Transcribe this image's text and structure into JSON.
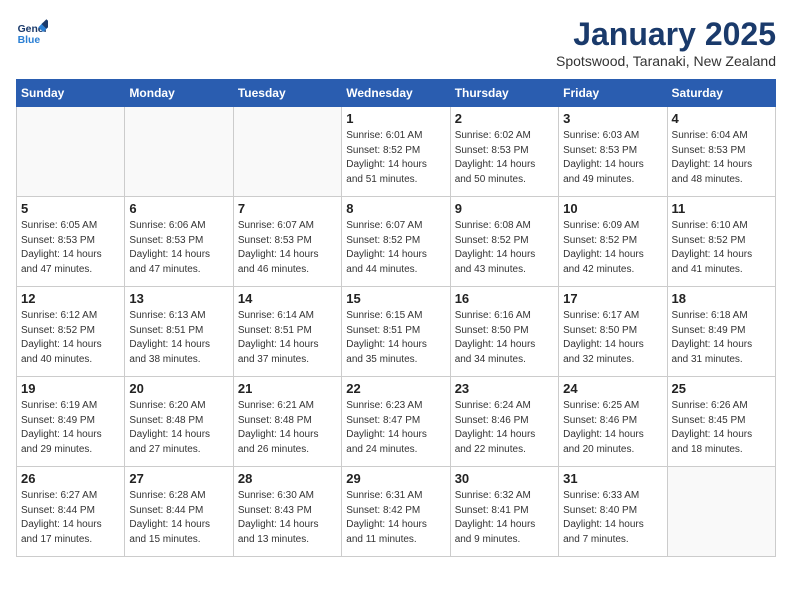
{
  "header": {
    "logo_line1": "General",
    "logo_line2": "Blue",
    "month": "January 2025",
    "location": "Spotswood, Taranaki, New Zealand"
  },
  "days_of_week": [
    "Sunday",
    "Monday",
    "Tuesday",
    "Wednesday",
    "Thursday",
    "Friday",
    "Saturday"
  ],
  "weeks": [
    [
      {
        "day": "",
        "info": ""
      },
      {
        "day": "",
        "info": ""
      },
      {
        "day": "",
        "info": ""
      },
      {
        "day": "1",
        "info": "Sunrise: 6:01 AM\nSunset: 8:52 PM\nDaylight: 14 hours\nand 51 minutes."
      },
      {
        "day": "2",
        "info": "Sunrise: 6:02 AM\nSunset: 8:53 PM\nDaylight: 14 hours\nand 50 minutes."
      },
      {
        "day": "3",
        "info": "Sunrise: 6:03 AM\nSunset: 8:53 PM\nDaylight: 14 hours\nand 49 minutes."
      },
      {
        "day": "4",
        "info": "Sunrise: 6:04 AM\nSunset: 8:53 PM\nDaylight: 14 hours\nand 48 minutes."
      }
    ],
    [
      {
        "day": "5",
        "info": "Sunrise: 6:05 AM\nSunset: 8:53 PM\nDaylight: 14 hours\nand 47 minutes."
      },
      {
        "day": "6",
        "info": "Sunrise: 6:06 AM\nSunset: 8:53 PM\nDaylight: 14 hours\nand 47 minutes."
      },
      {
        "day": "7",
        "info": "Sunrise: 6:07 AM\nSunset: 8:53 PM\nDaylight: 14 hours\nand 46 minutes."
      },
      {
        "day": "8",
        "info": "Sunrise: 6:07 AM\nSunset: 8:52 PM\nDaylight: 14 hours\nand 44 minutes."
      },
      {
        "day": "9",
        "info": "Sunrise: 6:08 AM\nSunset: 8:52 PM\nDaylight: 14 hours\nand 43 minutes."
      },
      {
        "day": "10",
        "info": "Sunrise: 6:09 AM\nSunset: 8:52 PM\nDaylight: 14 hours\nand 42 minutes."
      },
      {
        "day": "11",
        "info": "Sunrise: 6:10 AM\nSunset: 8:52 PM\nDaylight: 14 hours\nand 41 minutes."
      }
    ],
    [
      {
        "day": "12",
        "info": "Sunrise: 6:12 AM\nSunset: 8:52 PM\nDaylight: 14 hours\nand 40 minutes."
      },
      {
        "day": "13",
        "info": "Sunrise: 6:13 AM\nSunset: 8:51 PM\nDaylight: 14 hours\nand 38 minutes."
      },
      {
        "day": "14",
        "info": "Sunrise: 6:14 AM\nSunset: 8:51 PM\nDaylight: 14 hours\nand 37 minutes."
      },
      {
        "day": "15",
        "info": "Sunrise: 6:15 AM\nSunset: 8:51 PM\nDaylight: 14 hours\nand 35 minutes."
      },
      {
        "day": "16",
        "info": "Sunrise: 6:16 AM\nSunset: 8:50 PM\nDaylight: 14 hours\nand 34 minutes."
      },
      {
        "day": "17",
        "info": "Sunrise: 6:17 AM\nSunset: 8:50 PM\nDaylight: 14 hours\nand 32 minutes."
      },
      {
        "day": "18",
        "info": "Sunrise: 6:18 AM\nSunset: 8:49 PM\nDaylight: 14 hours\nand 31 minutes."
      }
    ],
    [
      {
        "day": "19",
        "info": "Sunrise: 6:19 AM\nSunset: 8:49 PM\nDaylight: 14 hours\nand 29 minutes."
      },
      {
        "day": "20",
        "info": "Sunrise: 6:20 AM\nSunset: 8:48 PM\nDaylight: 14 hours\nand 27 minutes."
      },
      {
        "day": "21",
        "info": "Sunrise: 6:21 AM\nSunset: 8:48 PM\nDaylight: 14 hours\nand 26 minutes."
      },
      {
        "day": "22",
        "info": "Sunrise: 6:23 AM\nSunset: 8:47 PM\nDaylight: 14 hours\nand 24 minutes."
      },
      {
        "day": "23",
        "info": "Sunrise: 6:24 AM\nSunset: 8:46 PM\nDaylight: 14 hours\nand 22 minutes."
      },
      {
        "day": "24",
        "info": "Sunrise: 6:25 AM\nSunset: 8:46 PM\nDaylight: 14 hours\nand 20 minutes."
      },
      {
        "day": "25",
        "info": "Sunrise: 6:26 AM\nSunset: 8:45 PM\nDaylight: 14 hours\nand 18 minutes."
      }
    ],
    [
      {
        "day": "26",
        "info": "Sunrise: 6:27 AM\nSunset: 8:44 PM\nDaylight: 14 hours\nand 17 minutes."
      },
      {
        "day": "27",
        "info": "Sunrise: 6:28 AM\nSunset: 8:44 PM\nDaylight: 14 hours\nand 15 minutes."
      },
      {
        "day": "28",
        "info": "Sunrise: 6:30 AM\nSunset: 8:43 PM\nDaylight: 14 hours\nand 13 minutes."
      },
      {
        "day": "29",
        "info": "Sunrise: 6:31 AM\nSunset: 8:42 PM\nDaylight: 14 hours\nand 11 minutes."
      },
      {
        "day": "30",
        "info": "Sunrise: 6:32 AM\nSunset: 8:41 PM\nDaylight: 14 hours\nand 9 minutes."
      },
      {
        "day": "31",
        "info": "Sunrise: 6:33 AM\nSunset: 8:40 PM\nDaylight: 14 hours\nand 7 minutes."
      },
      {
        "day": "",
        "info": ""
      }
    ]
  ]
}
